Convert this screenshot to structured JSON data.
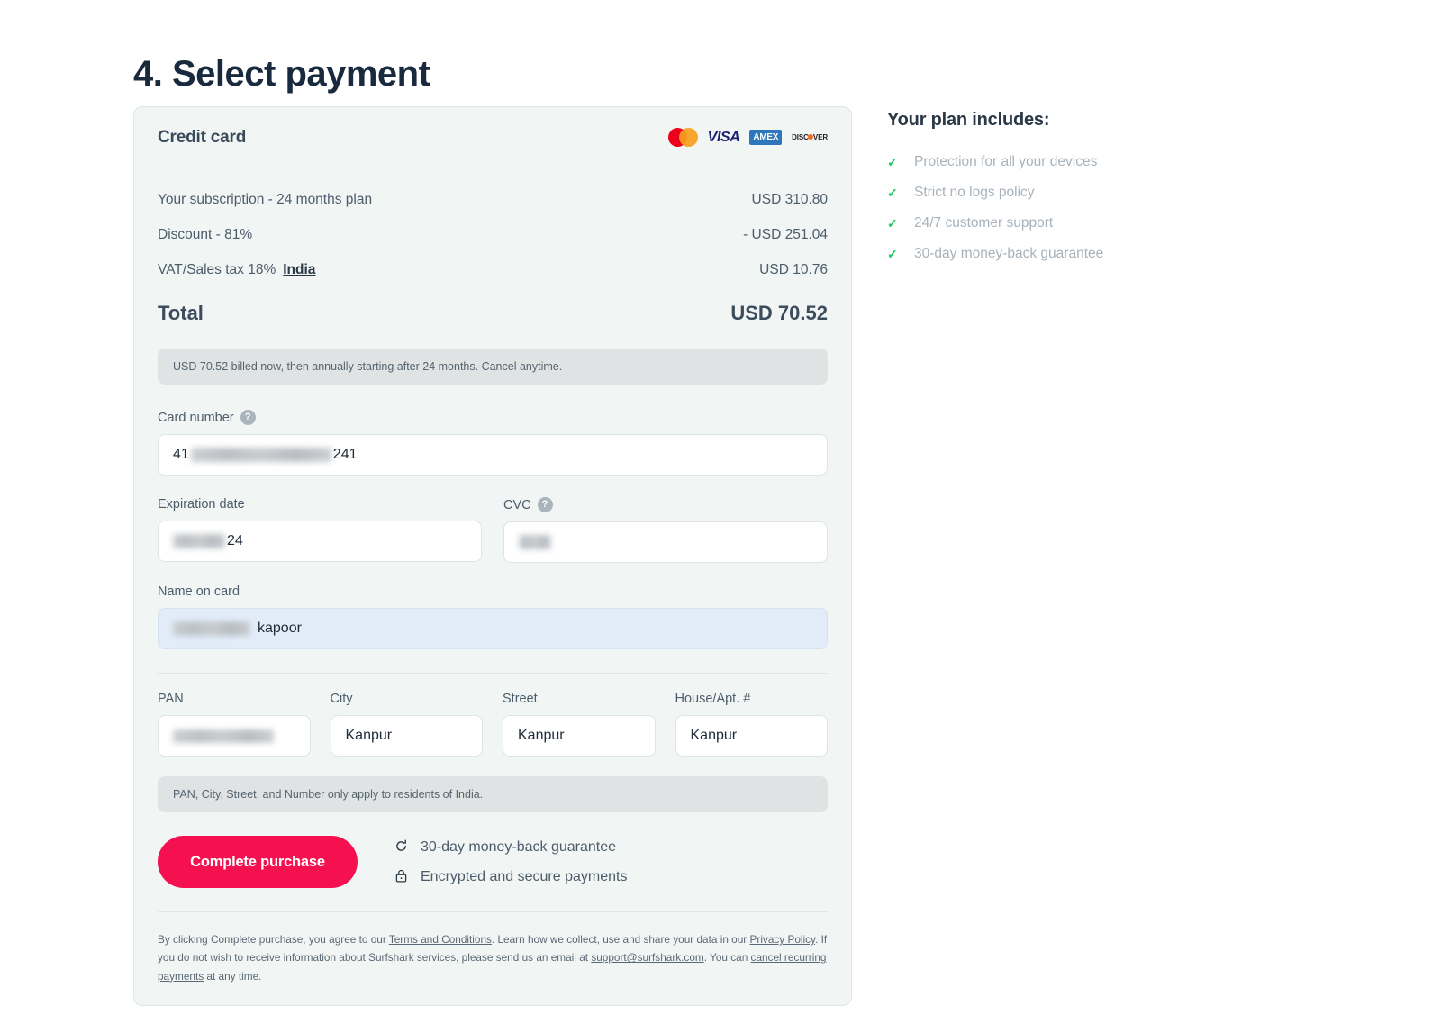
{
  "page": {
    "title": "4. Select payment"
  },
  "payment_panel": {
    "header": {
      "title": "Credit card",
      "brands": [
        "mastercard",
        "visa",
        "amex",
        "discover"
      ],
      "visa_label": "VISA",
      "amex_label": "AMEX",
      "discover_prefix": "DISC",
      "discover_suffix": "VER"
    },
    "summary": {
      "rows": [
        {
          "label": "Your subscription - 24 months plan",
          "amount": "USD 310.80"
        },
        {
          "label": "Discount - 81%",
          "amount": "- USD 251.04"
        }
      ],
      "tax": {
        "label": "VAT/Sales tax 18%",
        "country": "India",
        "amount": "USD 10.76"
      },
      "total": {
        "label": "Total",
        "amount": "USD 70.52"
      },
      "billing_notice": "USD 70.52 billed now, then annually starting after 24 months. Cancel anytime."
    },
    "fields": {
      "card_number": {
        "label": "Card number",
        "help": "?",
        "value_prefix": "41",
        "value_suffix": "241"
      },
      "expiration": {
        "label": "Expiration date",
        "value_suffix": "24"
      },
      "cvc": {
        "label": "CVC",
        "help": "?"
      },
      "name_on_card": {
        "label": "Name on card",
        "value_suffix": "kapoor"
      },
      "pan": {
        "label": "PAN",
        "value": ""
      },
      "city": {
        "label": "City",
        "value": "Kanpur"
      },
      "street": {
        "label": "Street",
        "value": "Kanpur"
      },
      "house": {
        "label": "House/Apt. #",
        "value": "Kanpur"
      },
      "residents_notice": "PAN, City, Street, and Number only apply to residents of India."
    },
    "cta": {
      "button_label": "Complete purchase",
      "trust": [
        {
          "icon": "money-back-icon",
          "label": "30-day money-back guarantee"
        },
        {
          "icon": "lock-icon",
          "label": "Encrypted and secure payments"
        }
      ]
    },
    "legal": {
      "part1": "By clicking Complete purchase, you agree to our ",
      "link_terms": "Terms and Conditions",
      "part2": ". Learn how we collect, use and share your data in our ",
      "link_privacy": "Privacy Policy",
      "part3": ". If you do not wish to receive information about Surfshark services, please send us an email at ",
      "link_email": "support@surfshark.com",
      "part4": ". You can ",
      "link_cancel": "cancel recurring payments",
      "part5": " at any time."
    }
  },
  "plan": {
    "title": "Your plan includes:",
    "items": [
      {
        "label": "Protection for all your devices"
      },
      {
        "label": "Strict no logs policy"
      },
      {
        "label": "24/7 customer support"
      },
      {
        "label": "30-day money-back guarantee"
      }
    ]
  },
  "colors": {
    "accent": "#f5114f",
    "check": "#22c55e",
    "panel_bg": "#f1f5f4",
    "title": "#192a3e"
  }
}
